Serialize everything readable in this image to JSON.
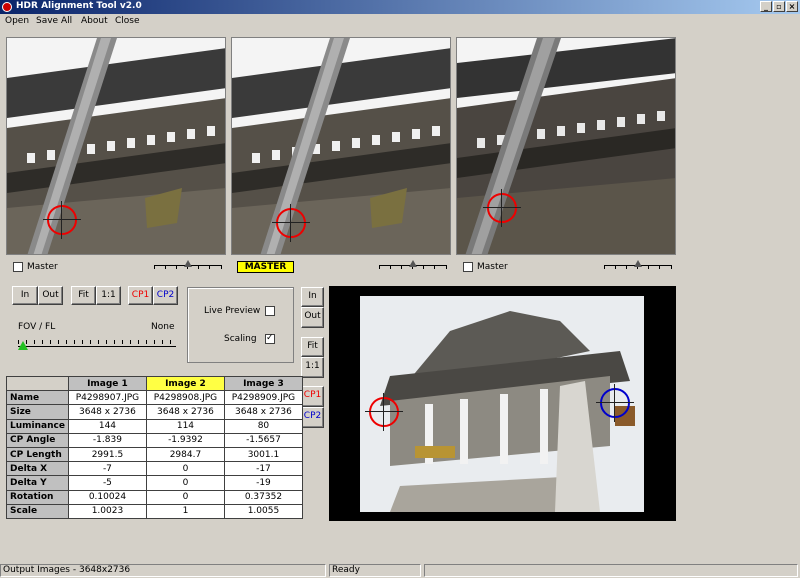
{
  "window": {
    "title": "HDR Alignment Tool  v2.0",
    "minimize": "_",
    "maximize": "▫",
    "close": "×"
  },
  "menu": [
    {
      "label": "Open"
    },
    {
      "label": "Save All"
    },
    {
      "label": "About"
    },
    {
      "label": "Close"
    }
  ],
  "image_panels": [
    {
      "name": "image-1",
      "master_label": "Master",
      "master_checked": false
    },
    {
      "name": "image-2",
      "badge": "MASTER"
    },
    {
      "name": "image-3",
      "master_label": "Master",
      "master_checked": false
    }
  ],
  "zoom_buttons": {
    "in": "In",
    "out": "Out",
    "fit": "Fit",
    "one_to_one": "1:1",
    "cp1": "CP1",
    "cp2": "CP2"
  },
  "fov": {
    "label": "FOV / FL",
    "value": "None"
  },
  "options": {
    "live_preview_label": "Live Preview",
    "live_preview_checked": false,
    "scaling_label": "Scaling",
    "scaling_checked": true
  },
  "preview_buttons": {
    "in": "In",
    "out": "Out",
    "fit": "Fit",
    "one_to_one": "1:1",
    "cp1": "CP1",
    "cp2": "CP2"
  },
  "table": {
    "columns": [
      "Image 1",
      "Image 2",
      "Image 3"
    ],
    "highlight_column": 1,
    "rows": [
      {
        "label": "Name",
        "values": [
          "P4298907.JPG",
          "P4298908.JPG",
          "P4298909.JPG"
        ]
      },
      {
        "label": "Size",
        "values": [
          "3648 x 2736",
          "3648 x 2736",
          "3648 x 2736"
        ]
      },
      {
        "label": "Luminance",
        "values": [
          "144",
          "114",
          "80"
        ]
      },
      {
        "label": "CP Angle",
        "values": [
          "-1.839",
          "-1.9392",
          "-1.5657"
        ]
      },
      {
        "label": "CP Length",
        "values": [
          "2991.5",
          "2984.7",
          "3001.1"
        ]
      },
      {
        "label": "Delta X",
        "values": [
          "-7",
          "0",
          "-17"
        ]
      },
      {
        "label": "Delta Y",
        "values": [
          "-5",
          "0",
          "-19"
        ]
      },
      {
        "label": "Rotation",
        "values": [
          "0.10024",
          "0",
          "0.37352"
        ]
      },
      {
        "label": "Scale",
        "values": [
          "1.0023",
          "1",
          "1.0055"
        ]
      }
    ]
  },
  "status": {
    "output": "Output Images - 3648x2736",
    "state": "Ready",
    "extra": ""
  },
  "colors": {
    "cp1": "#e00000",
    "cp2": "#0000cc",
    "master_badge": "#ffff00",
    "fov_thumb": "#22c022"
  }
}
